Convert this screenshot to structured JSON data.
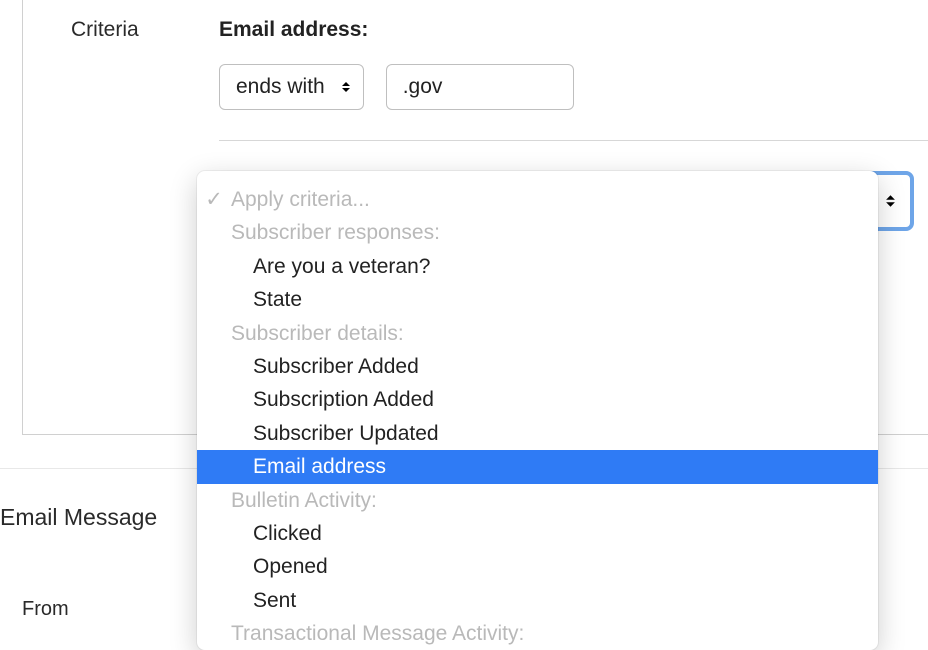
{
  "panel": {
    "label": "Criteria"
  },
  "criteria": {
    "field_title": "Email address:",
    "operator": {
      "selected": "ends with"
    },
    "value": ".gov"
  },
  "apply_select": {
    "placeholder": "Apply criteria...",
    "groups": [
      {
        "header": "Subscriber responses:",
        "options": [
          "Are you a veteran?",
          "State"
        ]
      },
      {
        "header": "Subscriber details:",
        "options": [
          "Subscriber Added",
          "Subscription Added",
          "Subscriber Updated",
          "Email address"
        ]
      },
      {
        "header": "Bulletin Activity:",
        "options": [
          "Clicked",
          "Opened",
          "Sent"
        ]
      },
      {
        "header": "Transactional Message Activity:",
        "options": []
      }
    ],
    "highlighted": "Email address"
  },
  "sections": {
    "email_message": "Email Message",
    "from": "From"
  }
}
